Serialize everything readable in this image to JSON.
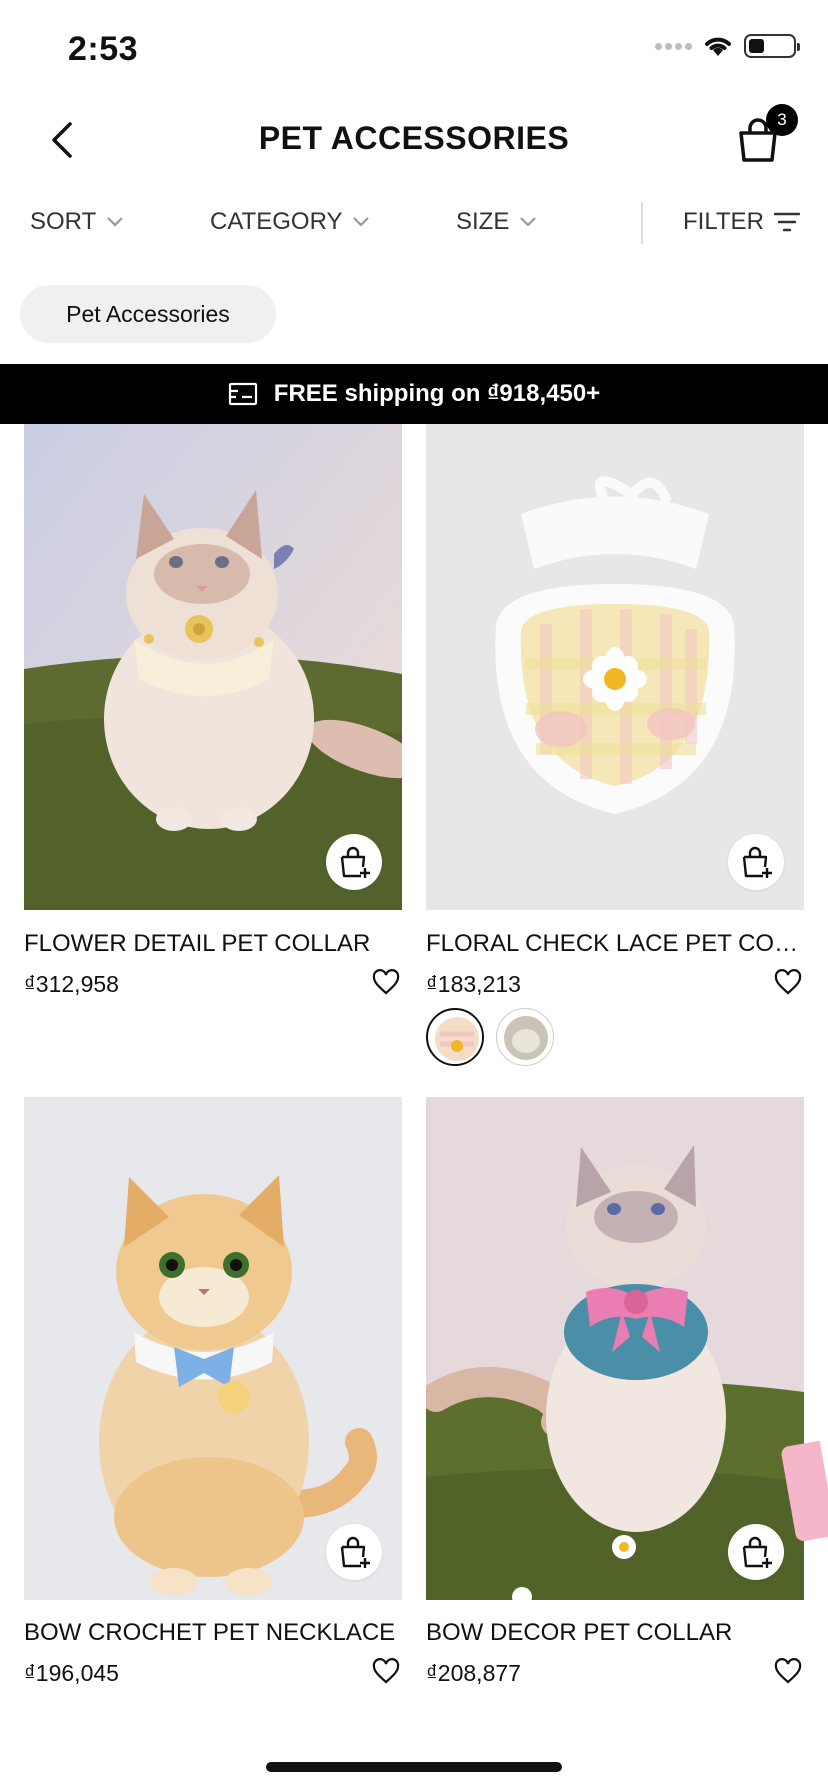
{
  "status_bar": {
    "time": "2:53"
  },
  "header": {
    "title": "PET ACCESSORIES",
    "cart_count": "3"
  },
  "filters": {
    "sort": "SORT",
    "category": "CATEGORY",
    "size": "SIZE",
    "filter": "FILTER"
  },
  "chip": {
    "label": "Pet Accessories"
  },
  "promo": {
    "text": "FREE shipping on ₫918,450+"
  },
  "products": [
    {
      "name": "FLOWER DETAIL PET COLLAR",
      "price": "₫312,958"
    },
    {
      "name": "FLORAL CHECK LACE PET COLLAR",
      "price": "₫183,213"
    },
    {
      "name": "BOW CROCHET PET NECKLACE",
      "price": "₫196,045"
    },
    {
      "name": "BOW DECOR PET COLLAR",
      "price": "₫208,877"
    }
  ],
  "icons": {
    "back": "chevron-left-icon",
    "cart": "shopping-bag-icon",
    "filter": "filter-lines-icon",
    "shipping": "shipping-card-icon",
    "quick_add": "bag-plus-icon",
    "wishlist": "heart-icon"
  }
}
